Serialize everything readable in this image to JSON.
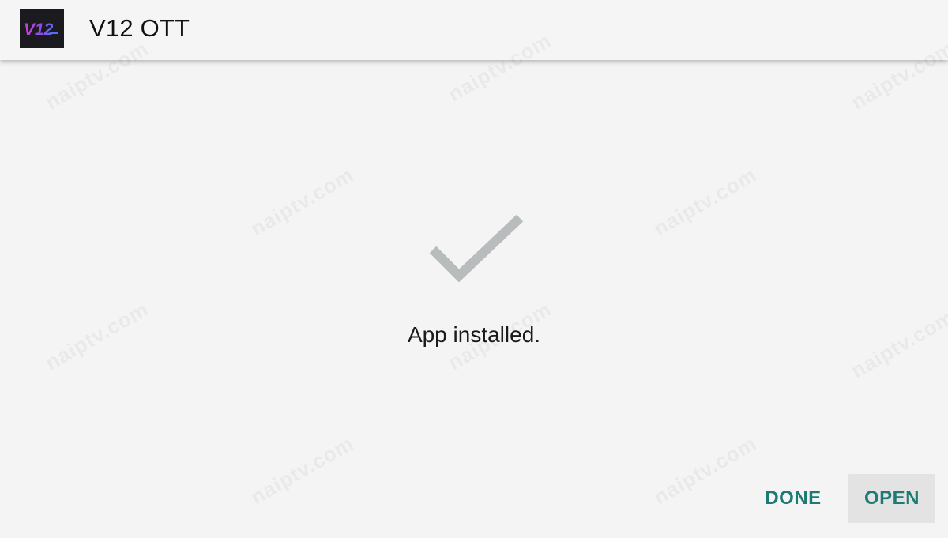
{
  "header": {
    "app_icon_text": "V12",
    "app_name": "V12 OTT"
  },
  "content": {
    "status_icon": "check-icon",
    "message": "App installed."
  },
  "actions": {
    "done_label": "DONE",
    "open_label": "OPEN"
  },
  "watermark": "naiptv.com",
  "colors": {
    "accent": "#1e7b74",
    "check": "#b8bcbc",
    "background": "#f4f4f4",
    "icon_bg": "#1b1b1f"
  }
}
